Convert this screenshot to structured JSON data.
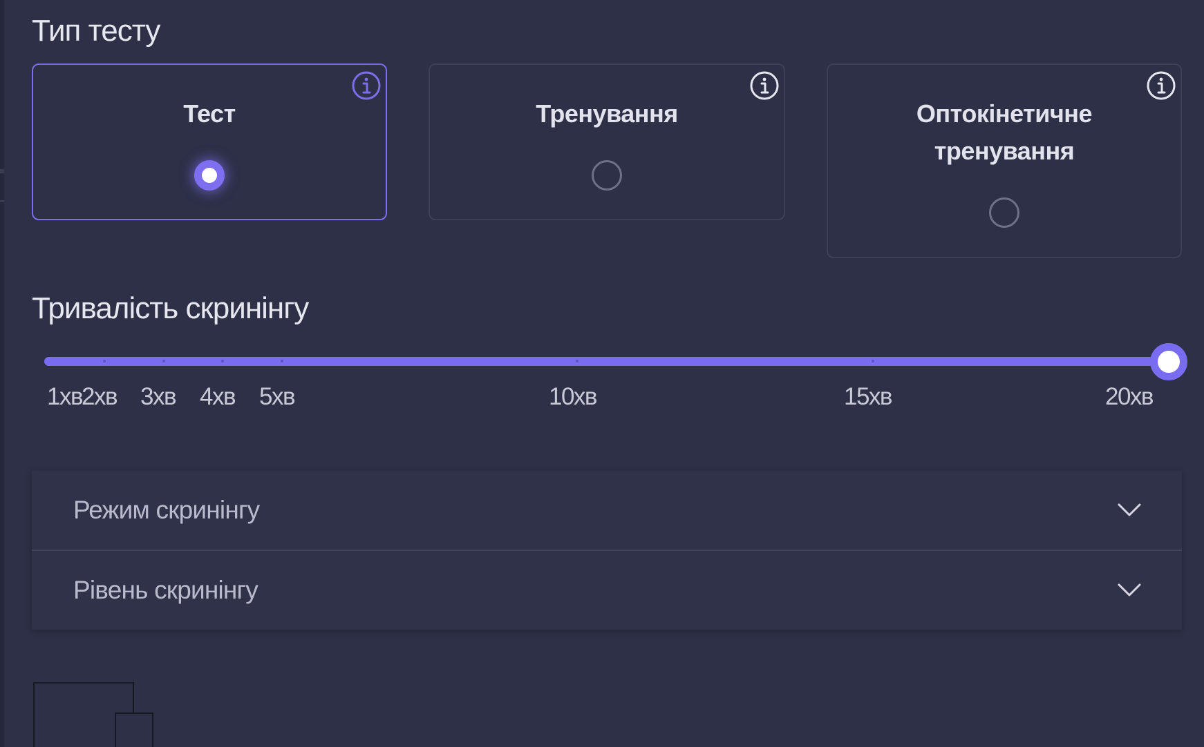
{
  "test_type": {
    "title": "Тип тесту",
    "options": [
      {
        "label": "Тест",
        "selected": true
      },
      {
        "label": "Тренування",
        "selected": false
      },
      {
        "label_line1": "Оптокінетичне",
        "label_line2": "тренування",
        "selected": false
      }
    ],
    "info_icon": "info-circle-icon"
  },
  "duration": {
    "title": "Тривалість скринінгу",
    "current_value": "20хв",
    "min_minutes": 1,
    "max_minutes": 20,
    "selected_minutes": 20,
    "marks": [
      "1хв",
      "2хв",
      "3хв",
      "4хв",
      "5хв",
      "10хв",
      "15хв",
      "20хв"
    ]
  },
  "accordion": {
    "items": [
      {
        "label": "Режим скринінгу",
        "icon": "chevron-down-icon"
      },
      {
        "label": "Рівень скринінгу",
        "icon": "chevron-down-icon"
      }
    ]
  },
  "colors": {
    "background": "#2d3047",
    "accent": "#7a6cf0",
    "text": "#e2e3ec",
    "muted_text": "#b9bacb",
    "border": "#3d4058"
  }
}
